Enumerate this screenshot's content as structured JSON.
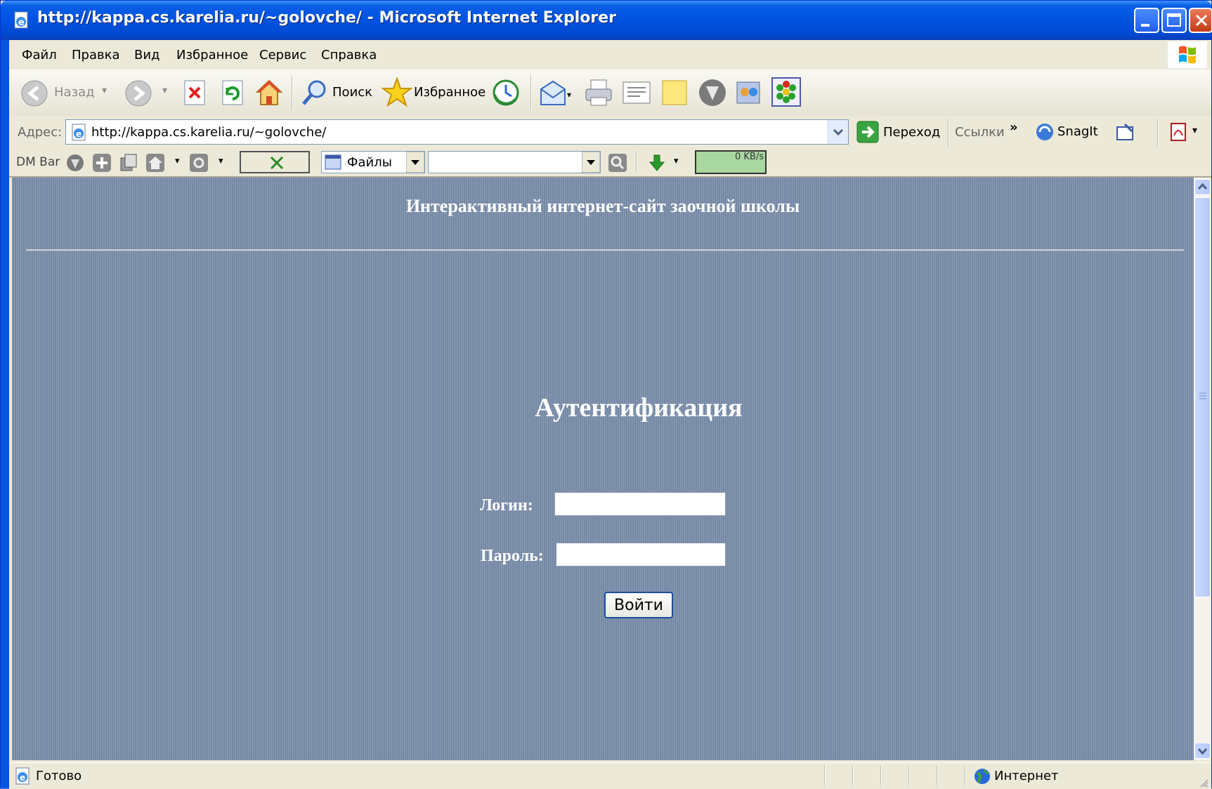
{
  "window": {
    "title": "http://kappa.cs.karelia.ru/~golovche/ - Microsoft Internet Explorer"
  },
  "menu": {
    "items": [
      "Файл",
      "Правка",
      "Вид",
      "Избранное",
      "Сервис",
      "Справка"
    ]
  },
  "toolbar": {
    "back_label": "Назад",
    "search_label": "Поиск",
    "favorites_label": "Избранное"
  },
  "address": {
    "label": "Адрес:",
    "url": "http://kappa.cs.karelia.ru/~golovche/",
    "go_label": "Переход",
    "links_label": "Ссылки",
    "snagit_label": "SnagIt"
  },
  "dmbar": {
    "label": "DM Bar",
    "files_label": "Файлы",
    "speed": "0 KB/s"
  },
  "page": {
    "site_title": "Интерактивный интернет-сайт заочной школы",
    "heading": "Аутентификация",
    "login_label": "Логин:",
    "password_label": "Пароль:",
    "login_value": "",
    "password_value": "",
    "submit_label": "Войти"
  },
  "status": {
    "text": "Готово",
    "zone": "Интернет"
  },
  "colors": {
    "title_bar": "#0054e3",
    "page_background": "#8193ad",
    "button_border": "#1c4ea0"
  }
}
